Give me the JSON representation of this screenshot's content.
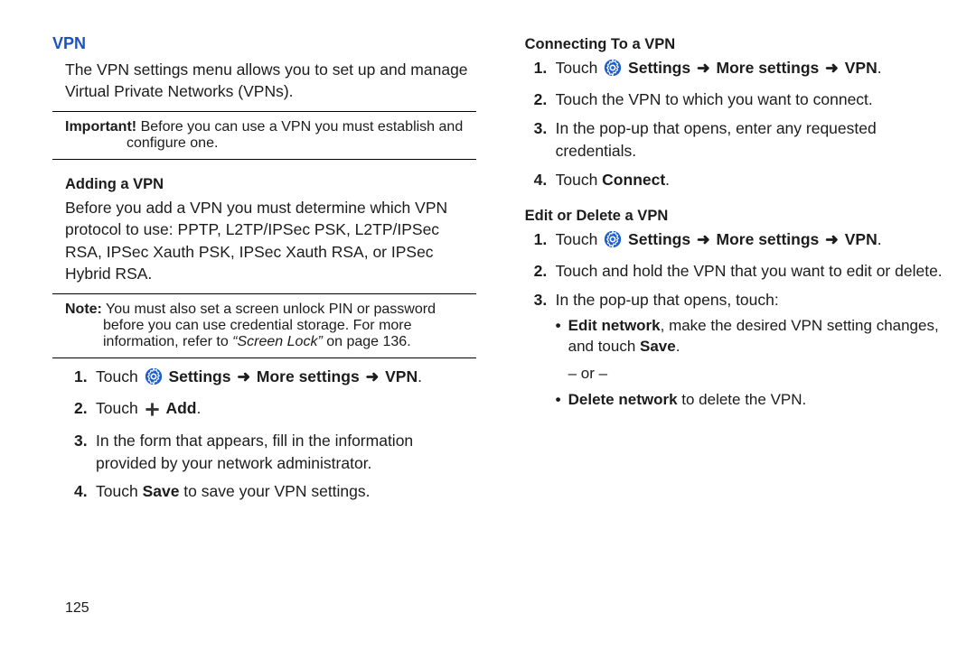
{
  "left": {
    "title": "VPN",
    "intro": "The VPN settings menu allows you to set up and manage Virtual Private Networks (VPNs).",
    "important_label": "Important!",
    "important_first": "Before you can use a VPN you must establish and",
    "important_cont": "configure one.",
    "adding_heading": "Adding a VPN",
    "adding_intro": "Before you add a VPN you must determine which VPN protocol to use: PPTP, L2TP/IPSec PSK, L2TP/IPSec RSA, IPSec Xauth PSK, IPSec Xauth RSA, or IPSec Hybrid RSA.",
    "note_label": "Note:",
    "note_first": "You must also set a screen unlock PIN or password",
    "note_cont1": "before you can use credential storage. For more",
    "note_cont2_prefix": "information, refer to ",
    "note_cont2_italic": "“Screen Lock”",
    "note_cont2_suffix": " on page 136.",
    "steps": {
      "touch": "Touch ",
      "settings_path_1": "Settings",
      "settings_path_2": "More settings",
      "settings_path_3": "VPN",
      "add": "Add",
      "step3": "In the form that appears, fill in the information provided by your network administrator.",
      "step4_pre": "Touch ",
      "step4_b": "Save",
      "step4_post": " to save your VPN settings."
    }
  },
  "right": {
    "connect_heading": "Connecting To a VPN",
    "touch": "Touch ",
    "settings_path_1": "Settings",
    "settings_path_2": "More settings",
    "settings_path_3": "VPN",
    "connect_step2": "Touch the VPN to which you want to connect.",
    "connect_step3": "In the pop-up that opens, enter any requested credentials.",
    "connect_step4_pre": "Touch ",
    "connect_step4_b": "Connect",
    "edit_heading": "Edit or Delete a VPN",
    "edit_step2": "Touch and hold the VPN that you want to edit or delete.",
    "edit_step3": "In the pop-up that opens, touch:",
    "bullet_edit_b": "Edit network",
    "bullet_edit_mid": ", make the desired VPN setting changes, and touch ",
    "bullet_edit_b2": "Save",
    "or": "– or –",
    "bullet_del_b": "Delete network",
    "bullet_del_post": " to delete the VPN."
  },
  "arrow": "➜",
  "page_number": "125"
}
